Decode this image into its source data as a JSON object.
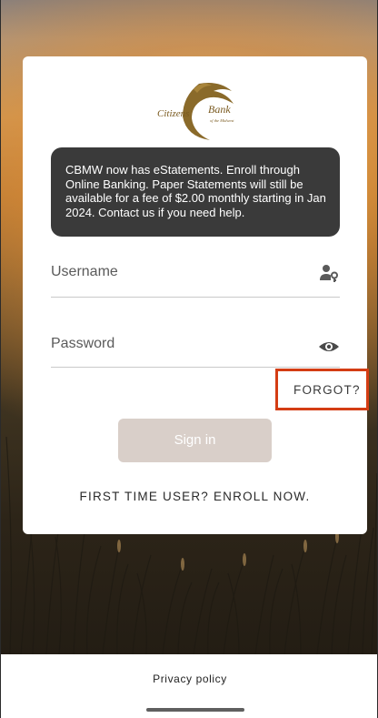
{
  "logo": {
    "brand_text_1": "Citizens",
    "brand_text_2": "Bank",
    "brand_tagline": "of the Midwest"
  },
  "notice": {
    "text": "CBMW now has eStatements. Enroll through Online Banking. Paper Statements will still be available for a fee of $2.00 monthly starting in Jan 2024. Contact us if you need help."
  },
  "login": {
    "username_placeholder": "Username",
    "password_placeholder": "Password",
    "forgot_label": "FORGOT?",
    "signin_label": "Sign in",
    "enroll_label": "FIRST TIME USER? ENROLL NOW."
  },
  "footer": {
    "privacy_label": "Privacy policy"
  },
  "icons": {
    "username": "user-key-icon",
    "password": "eye-icon"
  },
  "colors": {
    "highlight_border": "#d43d14",
    "notice_bg": "#3a3a3a",
    "signin_bg": "#d9cfc9",
    "logo_gold": "#8a6a2a"
  }
}
